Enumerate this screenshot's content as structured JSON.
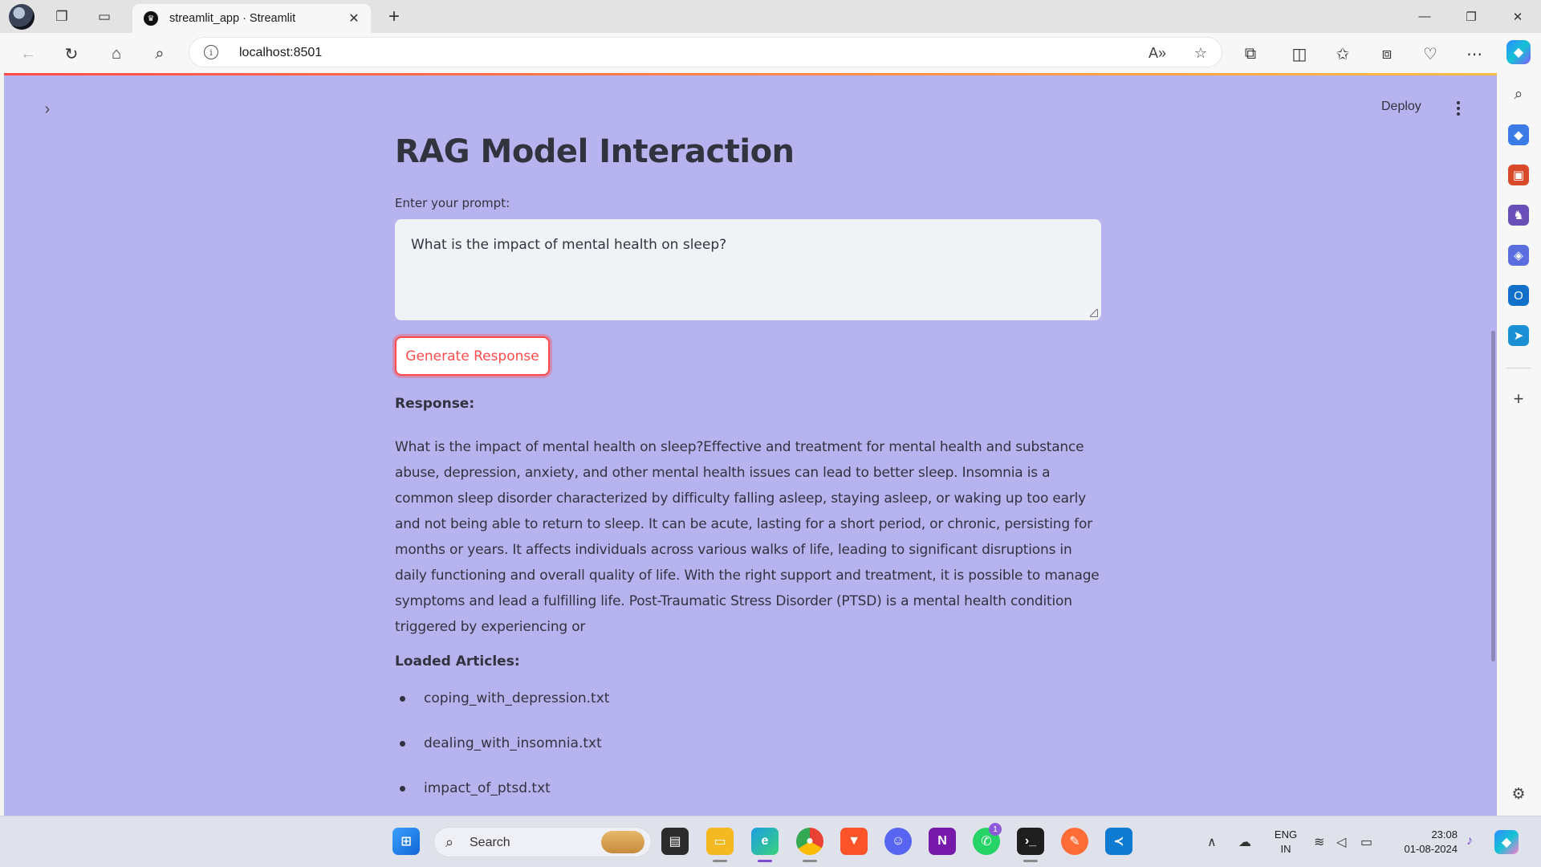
{
  "browser": {
    "tab_title": "streamlit_app · Streamlit",
    "tab_close": "✕",
    "new_tab": "+",
    "url": "localhost:8501",
    "window": {
      "minimize": "—",
      "maximize": "❐",
      "close": "✕"
    }
  },
  "app": {
    "header": {
      "deploy_label": "Deploy"
    },
    "title": "RAG Model Interaction",
    "prompt_label": "Enter your prompt:",
    "prompt_value": "What is the impact of mental health on sleep?",
    "button_label": "Generate Response",
    "response_label": "Response:",
    "response_text": "What is the impact of mental health on sleep?Effective and treatment for mental health and substance abuse, depression, anxiety, and other mental health issues can lead to better sleep. Insomnia is a common sleep disorder characterized by difficulty falling asleep, staying asleep, or waking up too early and not being able to return to sleep. It can be acute, lasting for a short period, or chronic, persisting for months or years. It affects individuals across various walks of life, leading to significant disruptions in daily functioning and overall quality of life. With the right support and treatment, it is possible to manage symptoms and lead a fulfilling life. Post-Traumatic Stress Disorder (PTSD) is a mental health condition triggered by experiencing or",
    "articles_label": "Loaded Articles:",
    "articles": [
      "coping_with_depression.txt",
      "dealing_with_insomnia.txt",
      "impact_of_ptsd.txt"
    ]
  },
  "taskbar": {
    "search_label": "Search",
    "whatsapp_badge": "1",
    "language_line1": "ENG",
    "language_line2": "IN",
    "time": "23:08",
    "date": "01-08-2024"
  },
  "colors": {
    "page_background": "#b7b3ef",
    "primary_red": "#ff4b4b",
    "text": "#31333f",
    "textarea_bg": "#f0f2f6"
  }
}
